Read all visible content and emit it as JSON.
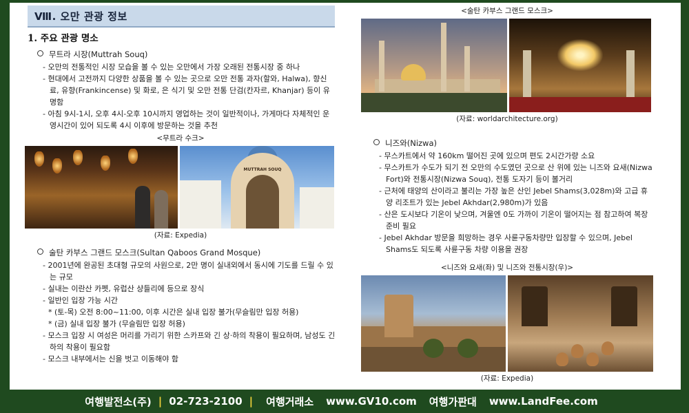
{
  "section": {
    "title": "Ⅷ. 오만 관광 정보"
  },
  "left": {
    "heading": "1. 주요 관광 명소",
    "muttrah": {
      "title": "무트라 시장(Muttrah Souq)",
      "bullets": [
        "- 오만의 전통적인 시장 모습을 볼 수 있는 오만에서 가장 오래된 전통시장 중 하나",
        "- 현대에서 고전까지 다양한 상품을 볼 수 있는 곳으로 오만 전통 과자(할와, Halwa), 향신료, 유향(Frankincense) 및 화로, 은 식기 및 오만 전통 단검(칸자르, Khanjar) 등이 유명함",
        "- 아침 9시-1시, 오후 4시-오후 10시까지 영업하는 것이 일반적이나, 가게마다 자체적인 운영시간이 있어 되도록 4시 이후에 방문하는 것을 추천"
      ],
      "photo_caption": "<무트라 수크>",
      "source": "(자료: Expedia)",
      "gate_sign": "MUTTRAH SOUQ"
    },
    "mosque": {
      "title": "술탄 카부스 그랜드 모스크(Sultan Qaboos Grand Mosque)",
      "bullets": [
        "- 2001년에 완공된 초대형 규모의 사원으로, 2만 명이 실내외에서 동시에 기도를 드릴 수 있는 규모",
        "- 실내는 이란산 카펫, 유럽산 샹들리에 등으로 장식",
        "- 일반인 입장 가능 시간"
      ],
      "sub_bullets": [
        "* (토-목) 오전 8:00~11:00, 이후 시간은 실내 입장 불가(무슬림만 입장 허용)",
        "* (금) 실내 입장 불가 (무슬림만 입장 허용)"
      ],
      "bullets2": [
        "- 모스크 입장 시 여성은 머리를 가리기 위한 스카프와 긴 상·하의 착용이 필요하며, 남성도 긴 하의 착용이 필요함",
        "- 모스크 내부에서는 신을 벗고 이동해야 함"
      ]
    }
  },
  "right": {
    "mosque_caption": "<술탄 카부스 그랜드 모스크>",
    "mosque_source": "(자료: worldarchitecture.org)",
    "nizwa": {
      "title": "니즈와(Nizwa)",
      "bullets": [
        "- 무스카트에서 약 160km 떨어진 곳에 있으며 편도 2시간가량 소요",
        "- 무스카트가 수도가 되기 전 오만의 수도였던 곳으로 산 위에 있는 니즈와 요새(Nizwa Fort)와 전통시장(Nizwa Souq), 전통 도자기 등이 볼거리",
        "- 근처에 태양의 산이라고 불리는 가장 높은 산인 Jebel Shams(3,028m)와 고급 휴양 리조트가 있는 Jebel Akhdar(2,980m)가 있음",
        "- 산은 도시보다 기온이 낮으며, 겨울엔 0도 가까이 기온이 떨어지는 점 참고하여 복장 준비 필요",
        "- Jebel Akhdar 방문을 희망하는 경우 사륜구동차량만 입장할 수 있으며, Jebel Shams도 되도록 사륜구동 차량 이용을 권장"
      ],
      "photo_caption": "<니즈와 요새(좌) 및 니즈와 전통시장(우)>",
      "source": "(자료: Expedia)"
    }
  },
  "footer": {
    "company": "여행발전소(주)",
    "phone": "02-723-2100",
    "label1": "여행거래소",
    "site1": "www.GV10.com",
    "label2": "여행가판대",
    "site2": "www.LandFee.com",
    "separator": "|"
  },
  "colors": {
    "frame": "#1f4a1f",
    "section_bar": "#c9d9ea",
    "separator": "#f2d23a"
  }
}
